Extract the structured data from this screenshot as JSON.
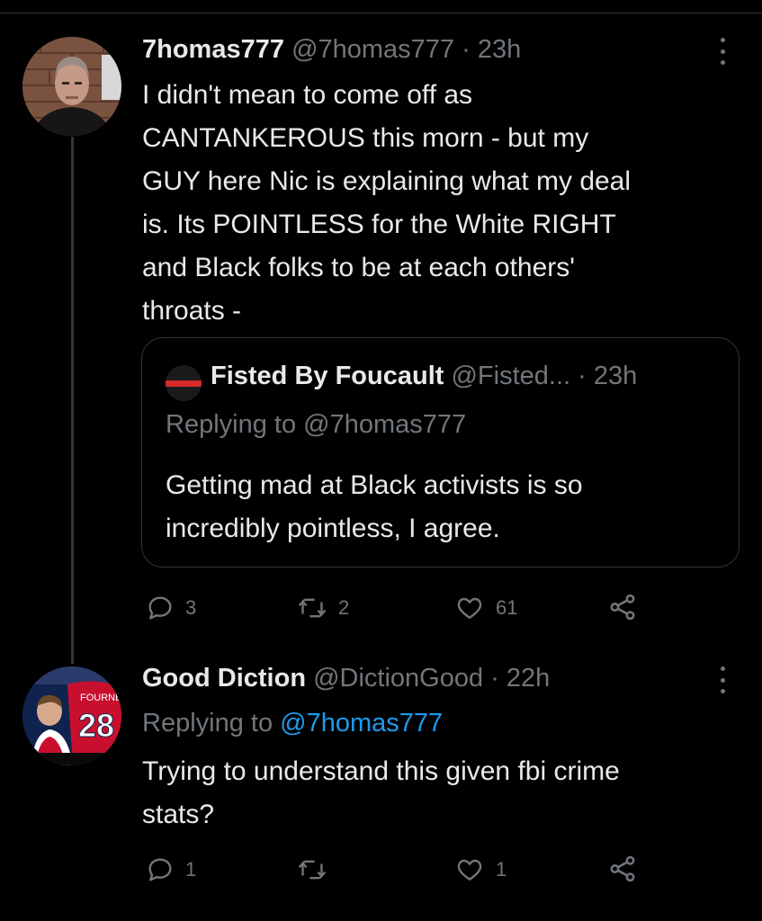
{
  "tweet1": {
    "display_name": "7homas777",
    "handle": "@7homas777",
    "time": "23h",
    "lines": [
      "I didn't mean to come off as",
      "CANTANKEROUS this morn - but my",
      "GUY here Nic is explaining what my deal",
      "is. Its POINTLESS for the White RIGHT",
      "and Black folks to be at each others'",
      "throats -"
    ],
    "quote": {
      "display_name": "Fisted By Foucault",
      "handle": "@Fisted...",
      "time": "23h",
      "replying_prefix": "Replying to",
      "replying_handle": "@7homas777",
      "lines": [
        "Getting mad at Black activists is so",
        "incredibly pointless, I agree."
      ]
    },
    "actions": {
      "replies": "3",
      "retweets": "2",
      "likes": "61"
    }
  },
  "tweet2": {
    "display_name": "Good Diction",
    "handle": "@DictionGood",
    "time": "22h",
    "replying_prefix": "Replying to",
    "replying_handle": "@7homas777",
    "lines": [
      "Trying to understand this given fbi crime",
      "stats?"
    ],
    "avatar_text": {
      "jersey_name": "FOURNE",
      "jersey_number": "28"
    },
    "actions": {
      "replies": "1",
      "retweets": "",
      "likes": "1"
    }
  },
  "separator": "·",
  "icons": [
    "more-icon",
    "reply-icon",
    "retweet-icon",
    "like-icon",
    "share-icon"
  ],
  "colors": {
    "background": "#000000",
    "text": "#e7e9ea",
    "muted": "#71767b",
    "link": "#1d9bf0",
    "border": "#2f3336"
  }
}
